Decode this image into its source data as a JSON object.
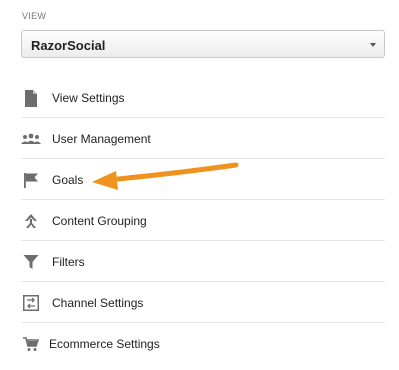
{
  "view": {
    "label": "VIEW",
    "selected": "RazorSocial"
  },
  "menu": {
    "items": [
      {
        "label": "View Settings",
        "icon": "document-icon"
      },
      {
        "label": "User Management",
        "icon": "users-icon"
      },
      {
        "label": "Goals",
        "icon": "flag-icon"
      },
      {
        "label": "Content Grouping",
        "icon": "content-grouping-icon"
      },
      {
        "label": "Filters",
        "icon": "filter-icon"
      },
      {
        "label": "Channel Settings",
        "icon": "channel-icon"
      },
      {
        "label": "Ecommerce Settings",
        "icon": "cart-icon"
      }
    ]
  },
  "annotation": {
    "arrow_color": "#f0921e",
    "points_to": "Goals"
  },
  "colors": {
    "icon": "#6d6d6d",
    "divider": "#e6e6e6"
  }
}
